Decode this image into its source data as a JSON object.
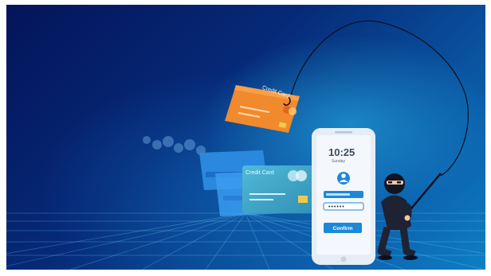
{
  "scene": {
    "orange_card_label": "Credit Card",
    "teal_card_label": "Credit Card",
    "phone": {
      "time": "10:25",
      "date": "Sunday",
      "pin_mask": "••••••",
      "confirm_label": "Confirm"
    }
  },
  "colors": {
    "background_dark": "#04145a",
    "background_light": "#0e7fc4",
    "card_orange": "#f08a2c",
    "card_teal": "#3aa6c9",
    "card_blue": "#2c8be0",
    "phone_accent": "#1e88d8",
    "chip": "#f2c94c"
  },
  "icons": {
    "profile": "user-icon",
    "hacker": "hacker-figure",
    "hook": "fishing-hook-icon"
  }
}
